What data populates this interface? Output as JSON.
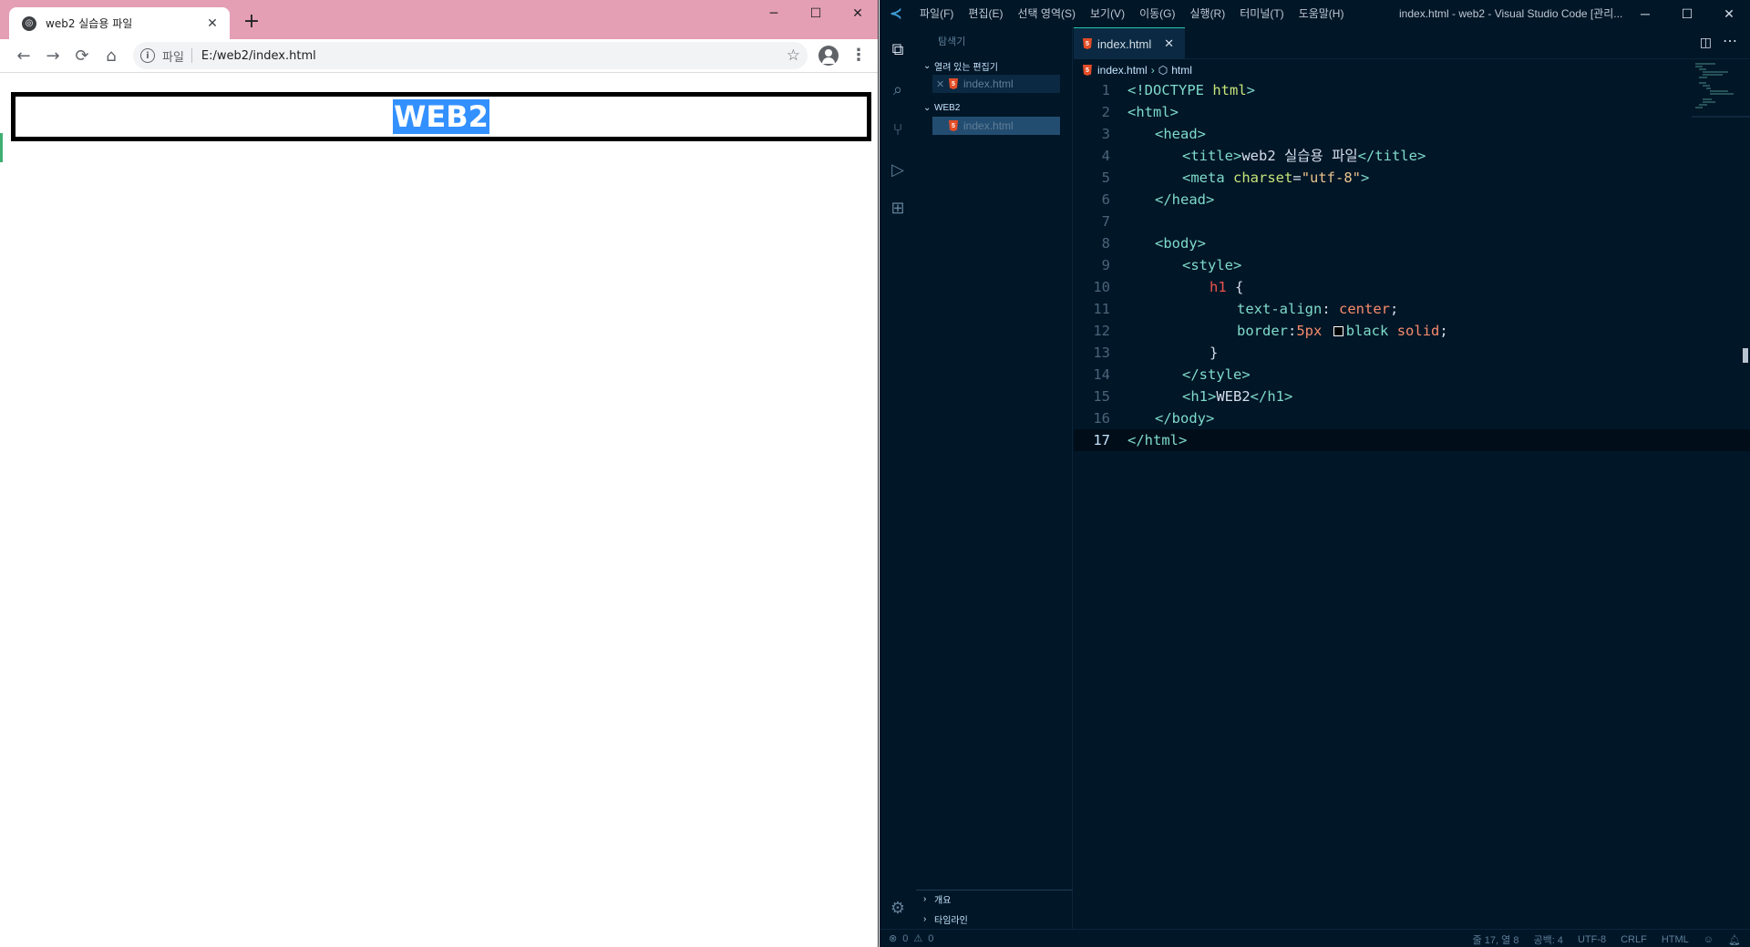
{
  "browser": {
    "tab_title": "web2 실습용 파일",
    "new_tab_symbol": "+",
    "window_controls": {
      "minimize": "─",
      "maximize": "☐",
      "close": "✕"
    },
    "omnibox": {
      "scheme_label": "파일",
      "url": "E:/web2/index.html"
    },
    "page": {
      "heading": "WEB2"
    }
  },
  "vscode": {
    "menu": [
      "파일(F)",
      "편집(E)",
      "선택 영역(S)",
      "보기(V)",
      "이동(G)",
      "실행(R)",
      "터미널(T)",
      "도움말(H)"
    ],
    "window_title": "index.html - web2 - Visual Studio Code [관리...",
    "window_controls": {
      "minimize": "─",
      "maximize": "☐",
      "close": "✕"
    },
    "sidebar": {
      "title": "탐색기",
      "open_editors_label": "열려 있는 편집기",
      "open_editor_file": "index.html",
      "folder_label": "WEB2",
      "folder_file": "index.html",
      "outline_label": "개요",
      "timeline_label": "타임라인"
    },
    "editor": {
      "tab_label": "index.html",
      "breadcrumb": [
        "index.html",
        "html"
      ],
      "active_line": 17,
      "lines": [
        {
          "n": "1"
        },
        {
          "n": "2"
        },
        {
          "n": "3"
        },
        {
          "n": "4"
        },
        {
          "n": "5"
        },
        {
          "n": "6"
        },
        {
          "n": "7"
        },
        {
          "n": "8"
        },
        {
          "n": "9"
        },
        {
          "n": "10"
        },
        {
          "n": "11"
        },
        {
          "n": "12"
        },
        {
          "n": "13"
        },
        {
          "n": "14"
        },
        {
          "n": "15"
        },
        {
          "n": "16"
        },
        {
          "n": "17"
        }
      ],
      "code": {
        "l1": [
          "<!DOCTYPE",
          "html",
          ">"
        ],
        "l2": "<html>",
        "l3": "<head>",
        "l4": [
          "<title>",
          "web2 실습용 파일",
          "</title>"
        ],
        "l5": [
          "<meta",
          "charset",
          "=",
          "\"utf-8\"",
          ">"
        ],
        "l6": "</head>",
        "l8": "<body>",
        "l9": "<style>",
        "l10": [
          "h1",
          "{"
        ],
        "l11": [
          "text-align",
          ":",
          "center",
          ";"
        ],
        "l12": [
          "border",
          ":",
          "5px",
          "black",
          "solid",
          ";"
        ],
        "l13": "}",
        "l14": "</style>",
        "l15": [
          "<h1>",
          "WEB2",
          "</h1>"
        ],
        "l16": "</body>",
        "l17": "</html>"
      }
    },
    "status": {
      "errors": "0",
      "warnings": "0",
      "position": "줄 17, 열 8",
      "indent": "공백: 4",
      "encoding": "UTF-8",
      "eol": "CRLF",
      "language": "HTML"
    },
    "colors": {
      "background": "#011627",
      "accent": "#21c7a8",
      "tag": "#7fdbca",
      "string": "#ecc48d",
      "keyword": "#ef5350"
    }
  }
}
